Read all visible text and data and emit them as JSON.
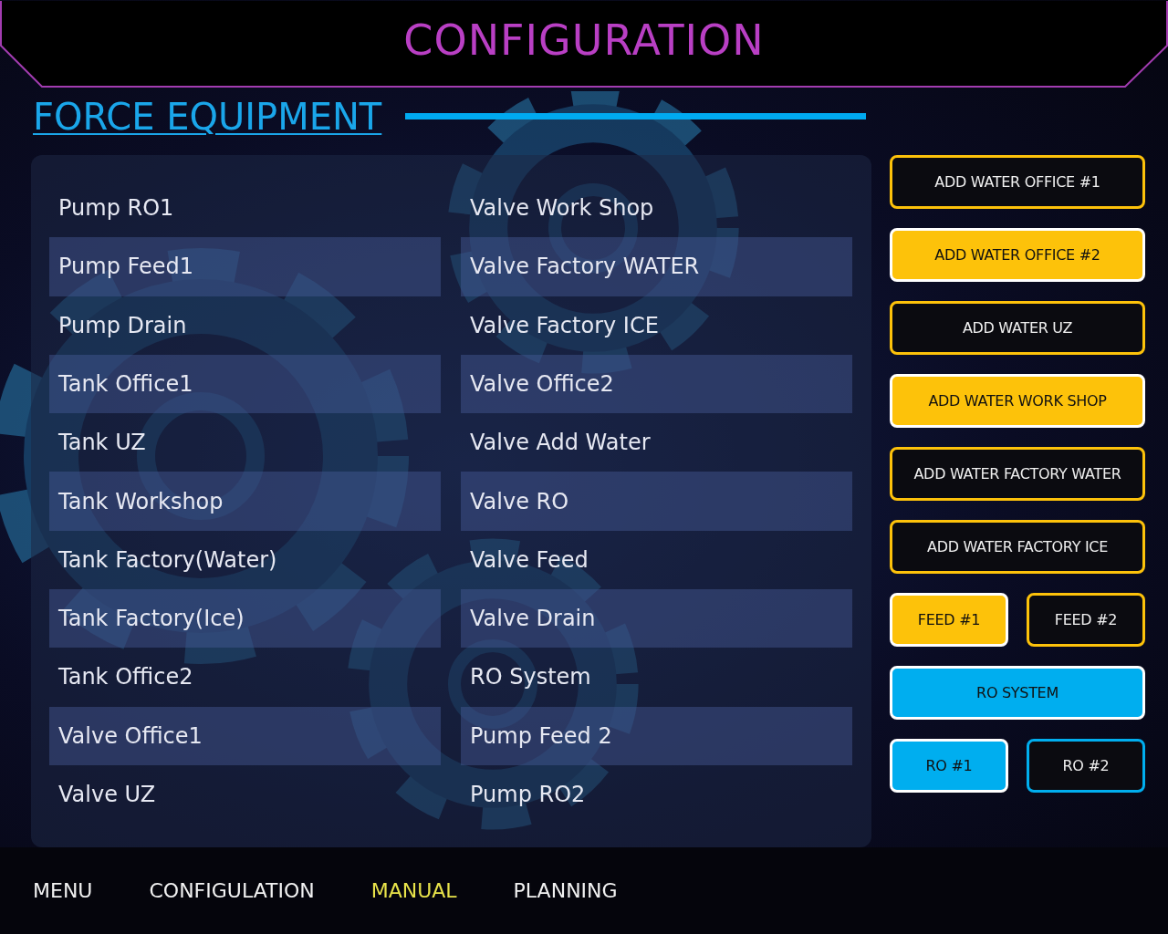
{
  "header": {
    "title": "CONFIGURATION"
  },
  "section": {
    "title": "FORCE EQUIPMENT"
  },
  "equipment": {
    "column_1": [
      "Pump RO1",
      "Pump Feed1",
      "Pump Drain",
      "Tank Office1",
      "Tank UZ",
      "Tank Workshop",
      "Tank Factory(Water)",
      "Tank Factory(Ice)",
      "Tank Office2",
      "Valve Office1",
      "Valve UZ"
    ],
    "column_2": [
      "Valve Work Shop",
      "Valve Factory WATER",
      "Valve Factory ICE",
      "Valve Office2",
      "Valve Add Water",
      "Valve RO",
      "Valve Feed",
      "Valve Drain",
      "RO System",
      "Pump Feed 2",
      "Pump RO2"
    ]
  },
  "button_rows": [
    {
      "buttons": [
        {
          "label": "ADD WATER OFFICE #1",
          "kind": "water",
          "on": false
        }
      ]
    },
    {
      "buttons": [
        {
          "label": "ADD WATER OFFICE #2",
          "kind": "water",
          "on": true
        }
      ]
    },
    {
      "buttons": [
        {
          "label": "ADD WATER UZ",
          "kind": "water",
          "on": false
        }
      ]
    },
    {
      "buttons": [
        {
          "label": "ADD WATER WORK SHOP",
          "kind": "water",
          "on": true
        }
      ]
    },
    {
      "buttons": [
        {
          "label": "ADD WATER FACTORY WATER",
          "kind": "water",
          "on": false
        }
      ]
    },
    {
      "buttons": [
        {
          "label": "ADD WATER FACTORY ICE",
          "kind": "water",
          "on": false
        }
      ]
    },
    {
      "buttons": [
        {
          "label": "FEED #1",
          "kind": "water",
          "on": true
        },
        {
          "label": "FEED #2",
          "kind": "water",
          "on": false
        }
      ]
    },
    {
      "buttons": [
        {
          "label": "RO SYSTEM",
          "kind": "ro",
          "on": true
        }
      ]
    },
    {
      "buttons": [
        {
          "label": "RO #1",
          "kind": "ro",
          "on": true
        },
        {
          "label": "RO #2",
          "kind": "ro",
          "on": false
        }
      ]
    }
  ],
  "nav": [
    {
      "label": "MENU",
      "selected": false
    },
    {
      "label": "CONFIGULATION",
      "selected": false
    },
    {
      "label": "MANUAL",
      "selected": true
    },
    {
      "label": "PLANNING",
      "selected": false
    }
  ]
}
